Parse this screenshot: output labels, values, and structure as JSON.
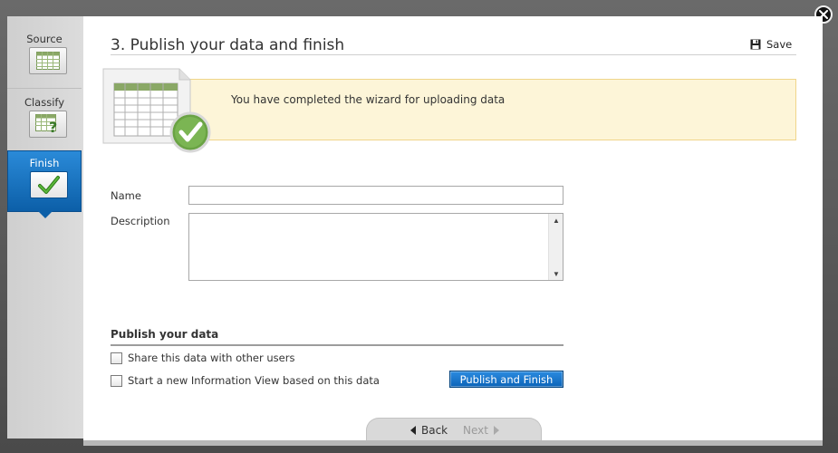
{
  "window": {
    "title": "3. Publish your data and finish",
    "save_label": "Save"
  },
  "steps": [
    {
      "label": "Source",
      "icon": "table-icon",
      "active": false
    },
    {
      "label": "Classify",
      "icon": "table-question-icon",
      "active": false
    },
    {
      "label": "Finish",
      "icon": "checkmark-icon",
      "active": true
    }
  ],
  "banner": {
    "message": "You have completed the wizard for uploading data",
    "background": "#fdf5d8",
    "border": "#f0d58a"
  },
  "form": {
    "name_label": "Name",
    "name_value": "",
    "description_label": "Description",
    "description_value": ""
  },
  "publish": {
    "section_title": "Publish your data",
    "share_label": "Share this data with other users",
    "share_checked": false,
    "new_view_label": "Start a new Information View based on this data",
    "new_view_checked": false,
    "button_label": "Publish and Finish"
  },
  "navigation": {
    "back_label": "Back",
    "next_label": "Next",
    "next_enabled": false
  },
  "colors": {
    "accent": "#0c64b8",
    "active_step": "#1a75c4"
  }
}
